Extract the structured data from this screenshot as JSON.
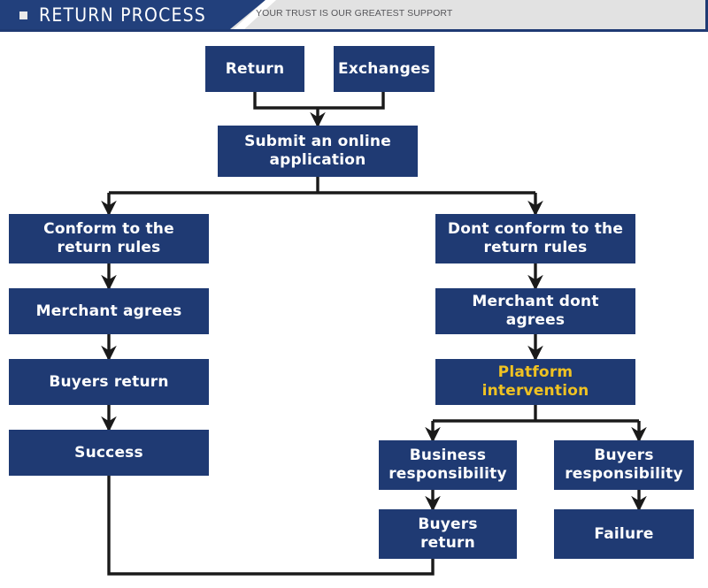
{
  "header": {
    "title": "RETURN PROCESS",
    "subtitle": "YOUR TRUST IS OUR GREATEST SUPPORT",
    "bullet_icon": "square-bullet-icon",
    "banner_color": "#22407c",
    "strip_color": "#e2e2e2",
    "accent_color": "#1f3a73"
  },
  "chart_data": {
    "type": "diagram",
    "title": "RETURN PROCESS",
    "node_color": "#1f3a73",
    "node_text_color": "#ffffff",
    "accent_text_color": "#efc222",
    "connector_color": "#1a1a1a",
    "nodes": [
      {
        "id": "return",
        "label": "Return",
        "highlight": false
      },
      {
        "id": "exchanges",
        "label": "Exchanges",
        "highlight": false
      },
      {
        "id": "submit",
        "label": "Submit an online\napplication",
        "highlight": false
      },
      {
        "id": "conform",
        "label": "Conform to the\nreturn rules",
        "highlight": false
      },
      {
        "id": "merchant-agrees",
        "label": "Merchant agrees",
        "highlight": false
      },
      {
        "id": "buyers-return-l",
        "label": "Buyers return",
        "highlight": false
      },
      {
        "id": "success",
        "label": "Success",
        "highlight": false
      },
      {
        "id": "dont-conform",
        "label": "Dont conform to the\nreturn rules",
        "highlight": false
      },
      {
        "id": "merchant-dont",
        "label": "Merchant dont agrees",
        "highlight": false
      },
      {
        "id": "platform",
        "label": "Platform\nintervention",
        "highlight": true
      },
      {
        "id": "business-resp",
        "label": "Business\nresponsibility",
        "highlight": false
      },
      {
        "id": "buyers-resp",
        "label": "Buyers\nresponsibility",
        "highlight": false
      },
      {
        "id": "buyers-return-r",
        "label": "Buyers\nreturn",
        "highlight": false
      },
      {
        "id": "failure",
        "label": "Failure",
        "highlight": false
      }
    ],
    "edges": [
      {
        "from": "return",
        "to": "submit"
      },
      {
        "from": "exchanges",
        "to": "submit"
      },
      {
        "from": "submit",
        "to": "conform"
      },
      {
        "from": "submit",
        "to": "dont-conform"
      },
      {
        "from": "conform",
        "to": "merchant-agrees"
      },
      {
        "from": "merchant-agrees",
        "to": "buyers-return-l"
      },
      {
        "from": "buyers-return-l",
        "to": "success"
      },
      {
        "from": "dont-conform",
        "to": "merchant-dont"
      },
      {
        "from": "merchant-dont",
        "to": "platform"
      },
      {
        "from": "platform",
        "to": "business-resp"
      },
      {
        "from": "platform",
        "to": "buyers-resp"
      },
      {
        "from": "business-resp",
        "to": "buyers-return-r"
      },
      {
        "from": "buyers-resp",
        "to": "failure"
      },
      {
        "from": "buyers-return-r",
        "to": "success"
      }
    ]
  }
}
